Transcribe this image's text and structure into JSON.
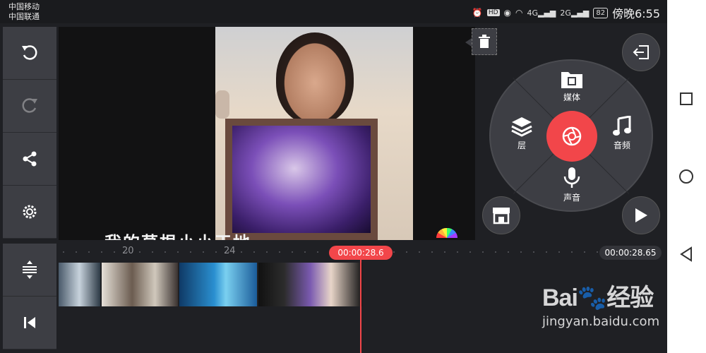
{
  "status_bar": {
    "carrier1": "中国移动",
    "carrier2": "中国联通",
    "hd": "HD",
    "net1": "4G",
    "net2": "2G",
    "battery": "82",
    "time": "傍晚6:55"
  },
  "left_toolbar": {
    "items": [
      "undo-icon",
      "redo-icon",
      "share-icon",
      "settings-icon"
    ],
    "bottom_items": [
      "track-height-icon",
      "skip-to-start-icon"
    ]
  },
  "preview": {
    "subtitle": "我的草根小小天地"
  },
  "wheel": {
    "media": "媒体",
    "layer": "层",
    "audio": "音频",
    "voice": "声音"
  },
  "timeline": {
    "tick_labels": [
      "20",
      "24"
    ],
    "playhead_time": "00:00:28.6",
    "total_time": "00:00:28.65"
  },
  "watermark": {
    "logo_left": "Bai",
    "logo_right": "经验",
    "url": "jingyan.baidu.com"
  },
  "colors": {
    "accent": "#f2464a",
    "panel": "#3d3e44",
    "background": "#1f2024"
  }
}
